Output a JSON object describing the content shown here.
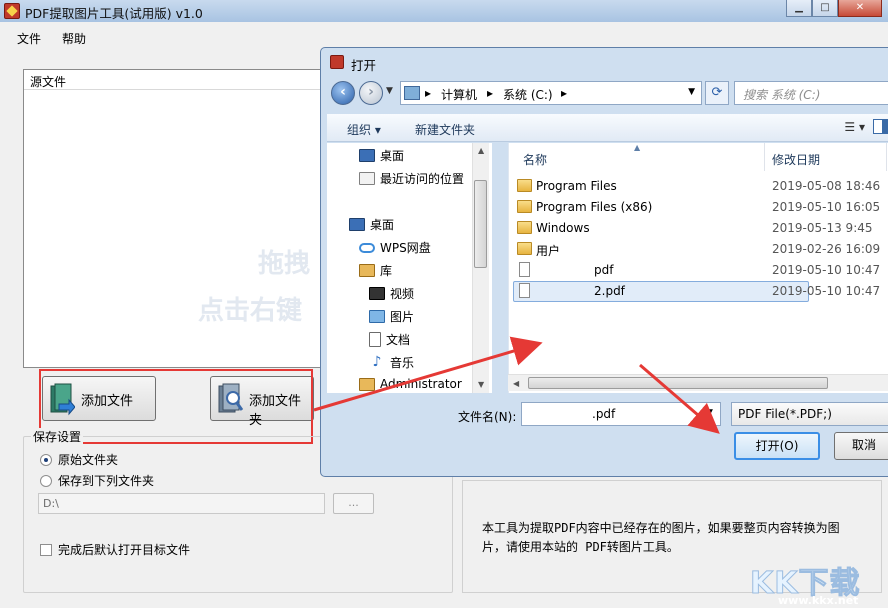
{
  "app": {
    "title": "PDF提取图片工具(试用版) v1.0",
    "menu": [
      "文件",
      "帮助"
    ],
    "source_header": "源文件",
    "watermark_line1": "拖拽",
    "watermark_line2": "点击右键",
    "add_file_button": "添加文件",
    "add_folder_button": "添加文件夹",
    "save_group_label": "保存设置",
    "radio_original": "原始文件夹",
    "radio_custom": "保存到下列文件夹",
    "path_value": "D:\\",
    "browse_label": "...",
    "open_after_label": "完成后默认打开目标文件",
    "info_text": "本工具为提取PDF内容中已经存在的图片，如果要整页内容转换为图片，请使用本站的 PDF转图片工具。",
    "corner_logo_text": "KK下载",
    "corner_logo_url": "www.kkx.net"
  },
  "dialog": {
    "title": "打开",
    "breadcrumb": [
      "计算机",
      "系统 (C:)"
    ],
    "search_placeholder": "搜索 系统 (C:)",
    "toolbar": {
      "organize": "组织 ▾",
      "new_folder": "新建文件夹"
    },
    "nav_items": [
      {
        "label": "桌面"
      },
      {
        "label": "最近访问的位置"
      },
      {
        "label": "桌面"
      },
      {
        "label": "WPS网盘"
      },
      {
        "label": "库"
      },
      {
        "label": "视频"
      },
      {
        "label": "图片"
      },
      {
        "label": "文档"
      },
      {
        "label": "音乐"
      },
      {
        "label": "Administrator"
      }
    ],
    "columns": {
      "name": "名称",
      "modified": "修改日期"
    },
    "files": [
      {
        "name": "Program Files",
        "date": "2019-05-08 18:46",
        "kind": "folder"
      },
      {
        "name": "Program Files (x86)",
        "date": "2019-05-10 16:05",
        "kind": "folder"
      },
      {
        "name": "Windows",
        "date": "2019-05-13 9:45",
        "kind": "folder"
      },
      {
        "name": "用户",
        "date": "2019-02-26 16:09",
        "kind": "folder"
      },
      {
        "name": "pdf",
        "date": "2019-05-10 10:47",
        "kind": "file"
      },
      {
        "name": "2.pdf",
        "date": "2019-05-10 10:47",
        "kind": "file",
        "selected": true
      }
    ],
    "filename_label": "文件名(N):",
    "filename_value": ".pdf",
    "filter_value": "PDF File(*.PDF;)",
    "open_button": "打开(O)",
    "cancel_button": "取消"
  },
  "colors": {
    "annotation_red": "#e53935",
    "accent_blue": "#3a8ee6"
  }
}
